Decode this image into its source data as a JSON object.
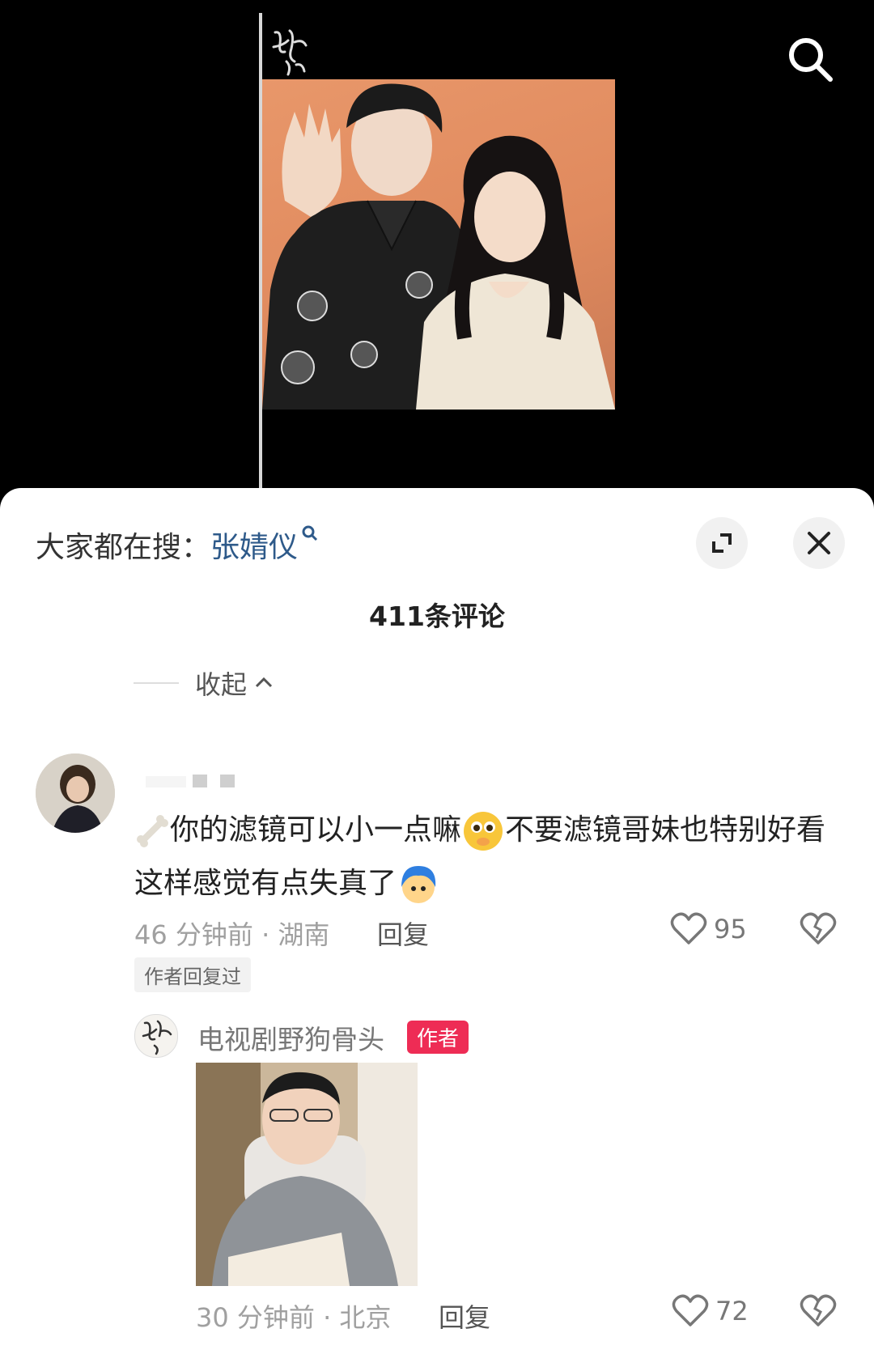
{
  "video": {
    "logo_text": "野狗骨头",
    "icon": "search-icon"
  },
  "panel": {
    "hot_search_prefix": "大家都在搜：",
    "hot_search_keyword": "张婧仪",
    "comment_count": "411条评论",
    "collapse_label": "收起",
    "expand_icon": "expand-icon",
    "close_icon": "close-icon"
  },
  "comment": {
    "text_before_emoji": "你的滤镜可以小一点嘛",
    "text_middle": "不要滤镜哥妹也特别好看 这样感觉有点失真了",
    "time": "46 分钟前",
    "location": "湖南",
    "reply_label": "回复",
    "likes": "95",
    "author_replied_tag": "作者回复过"
  },
  "reply": {
    "author_name": "电视剧野狗骨头",
    "author_badge": "作者",
    "avatar_text": "野狗骨头",
    "time": "30 分钟前",
    "location": "北京",
    "reply_label": "回复",
    "likes": "72"
  },
  "colors": {
    "accent": "#ee2c55",
    "keyword": "#2e5a8a",
    "photo_bg": "#e08a5e"
  }
}
